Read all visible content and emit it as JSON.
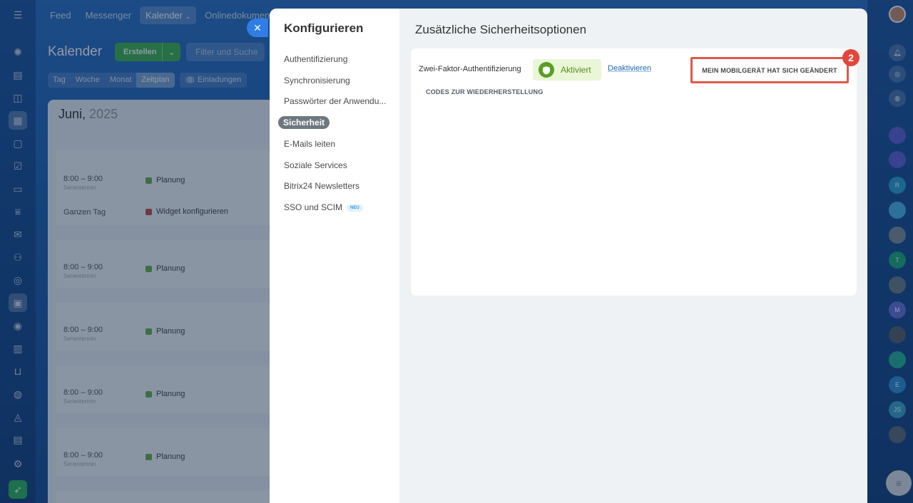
{
  "top_nav": {
    "items": [
      "Feed",
      "Messenger",
      "Kalender",
      "Onlinedokumente"
    ],
    "active_index": 2
  },
  "calendar": {
    "title": "Kalender",
    "create_label": "Erstellen",
    "filter_placeholder": "Filter und Suche",
    "view_tabs": [
      "Tag",
      "Woche",
      "Monat",
      "Zeitplan"
    ],
    "active_view": "Zeitplan",
    "invites_count": "0",
    "invites_label": "Einladungen",
    "month": "Juni,",
    "year": "2025",
    "events": [
      {
        "time": "8:00 – 9:00",
        "sub": "Serientermin",
        "title": "Planung",
        "color": "#6ab04c"
      },
      {
        "time": "Ganzen Tag",
        "sub": "",
        "title": "Widget konfigurieren",
        "color": "#c0504d"
      },
      {
        "time": "8:00 – 9:00",
        "sub": "Serientermin",
        "title": "Planung",
        "color": "#6ab04c"
      },
      {
        "time": "8:00 – 9:00",
        "sub": "Serientermin",
        "title": "Planung",
        "color": "#6ab04c"
      },
      {
        "time": "8:00 – 9:00",
        "sub": "Serientermin",
        "title": "Planung",
        "color": "#6ab04c"
      },
      {
        "time": "8:00 – 9:00",
        "sub": "Serientermin",
        "title": "Planung",
        "color": "#6ab04c"
      }
    ]
  },
  "panel": {
    "nav_title": "Konfigurieren",
    "nav_items": [
      {
        "label": "Authentifizierung"
      },
      {
        "label": "Synchronisierung"
      },
      {
        "label": "Passwörter der Anwendu..."
      },
      {
        "label": "Sicherheit",
        "active": true
      },
      {
        "label": "E-Mails leiten"
      },
      {
        "label": "Soziale Services"
      },
      {
        "label": "Bitrix24 Newsletters"
      },
      {
        "label": "SSO und SCIM",
        "badge": "NEU"
      }
    ],
    "content_title": "Zusätzliche Sicherheitsoptionen",
    "two_factor_label": "Zwei-Faktor-Authentifizierung",
    "status": "Aktiviert",
    "deactivate_label": "Deaktivieren",
    "mobile_changed_label": "MEIN MOBILGERÄT HAT SICH GEÄNDERT",
    "recovery_codes_label": "CODES ZUR WIEDERHERSTELLUNG",
    "step_badge": "2"
  },
  "right_rail": {
    "avatars": [
      {
        "initials": "",
        "color": "#5d5fd1"
      },
      {
        "initials": "",
        "color": "#5d5fd1"
      },
      {
        "initials": "R",
        "color": "#2a9fd0"
      },
      {
        "initials": "",
        "color": "#4ab3e8"
      },
      {
        "initials": "",
        "color": "#7f8c99"
      },
      {
        "initials": "T",
        "color": "#1bab7a"
      },
      {
        "initials": "",
        "color": "#6a7a85"
      },
      {
        "initials": "M",
        "color": "#6371d8"
      },
      {
        "initials": "",
        "color": "#55606b"
      },
      {
        "initials": "",
        "color": "#26b097"
      },
      {
        "initials": "E",
        "color": "#2a8fd4"
      },
      {
        "initials": "JS",
        "color": "#3aa3c7"
      },
      {
        "initials": "",
        "color": "#5c6b78"
      }
    ]
  },
  "colors": {
    "accent": "#2f7ee6",
    "highlight_border": "#e05a4b",
    "status_green": "#5a9e25"
  }
}
